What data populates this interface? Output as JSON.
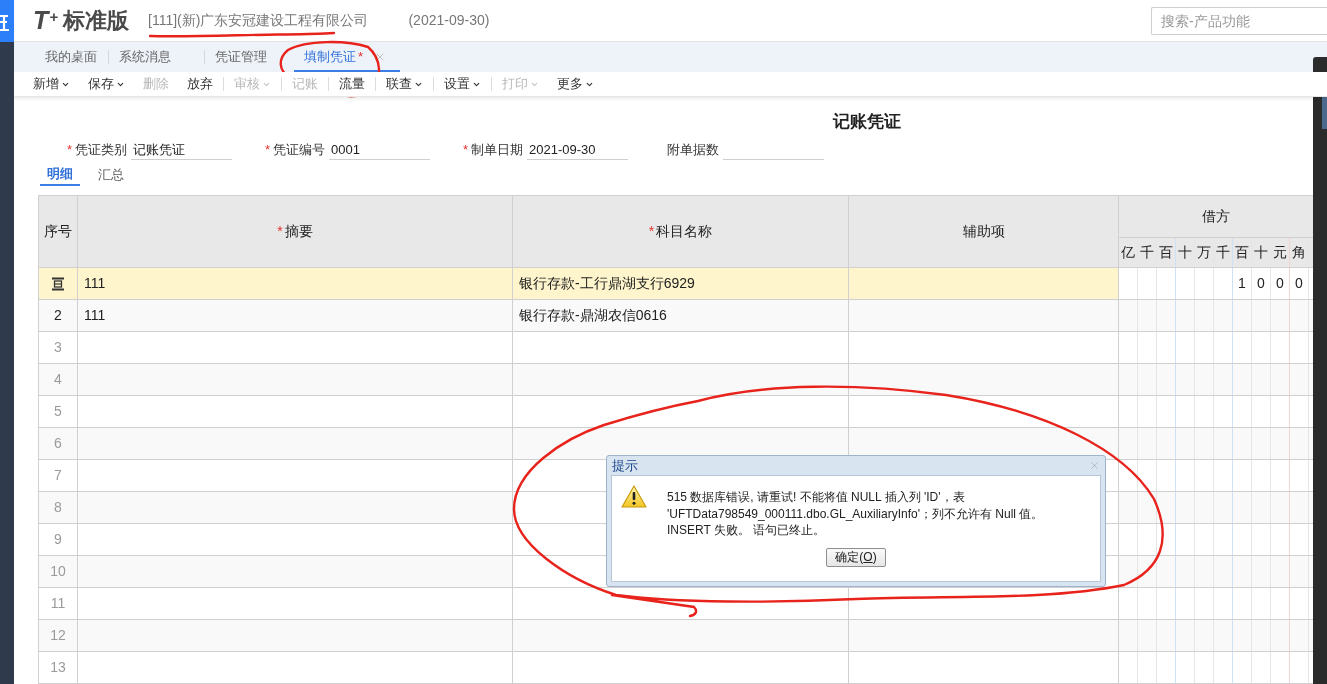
{
  "app": {
    "logo_mark": "T$^{+}$",
    "edition": "标准版",
    "company": "[111](新)广东安冠建设工程有限公司",
    "date": "(2021-09-30)"
  },
  "search": {
    "placeholder": "搜索-产品功能"
  },
  "tabs": [
    {
      "label": "我的桌面",
      "selected": false
    },
    {
      "label": "系统消息",
      "selected": false
    },
    {
      "label": "凭证管理",
      "selected": false
    },
    {
      "label": "填制凭证",
      "modified_mark": "*",
      "selected": true,
      "closable": true
    }
  ],
  "toolbar": [
    {
      "label": "新增",
      "menu": true,
      "disabled": false,
      "separator_after": false
    },
    {
      "label": "保存",
      "menu": true,
      "disabled": false,
      "separator_after": false
    },
    {
      "label": "删除",
      "menu": false,
      "disabled": true,
      "separator_after": false
    },
    {
      "label": "放弃",
      "menu": false,
      "disabled": false,
      "separator_after": true
    },
    {
      "label": "审核",
      "menu": true,
      "disabled": true,
      "separator_after": true
    },
    {
      "label": "记账",
      "menu": false,
      "disabled": true,
      "separator_after": true
    },
    {
      "label": "流量",
      "menu": false,
      "disabled": false,
      "separator_after": true
    },
    {
      "label": "联查",
      "menu": true,
      "disabled": false,
      "separator_after": true
    },
    {
      "label": "设置",
      "menu": true,
      "disabled": false,
      "separator_after": true
    },
    {
      "label": "打印",
      "menu": true,
      "disabled": true,
      "separator_after": false
    },
    {
      "label": "更多",
      "menu": true,
      "disabled": false,
      "separator_after": false
    }
  ],
  "voucher": {
    "title": "记账凭证",
    "fields": [
      {
        "required_mark": "*",
        "label": "凭证类别",
        "value": "记账凭证"
      },
      {
        "required_mark": "*",
        "label": "凭证编号",
        "value": "0001"
      },
      {
        "required_mark": "*",
        "label": "制单日期",
        "value": "2021-09-30"
      },
      {
        "label": "附单据数"
      }
    ],
    "view_tabs": [
      {
        "label": "明细",
        "selected": true
      },
      {
        "label": "汇总",
        "selected": false
      }
    ]
  },
  "table": {
    "columns": [
      {
        "label": "序号"
      },
      {
        "label": "摘要",
        "required_mark": "*"
      },
      {
        "label": "科目名称",
        "required_mark": "*"
      },
      {
        "label": "辅助项"
      }
    ],
    "debit": {
      "label": "借方",
      "digits": [
        "亿",
        "千",
        "百",
        "十",
        "万",
        "千",
        "百",
        "十",
        "元",
        "角"
      ]
    },
    "rows": [
      {
        "selected": true,
        "summary": "111",
        "account": "银行存款-工行鼎湖支行6929",
        "debit_digits": [
          "1",
          "0",
          "0",
          "0"
        ]
      },
      {
        "selected": false,
        "seq": "2",
        "summary": "111",
        "account": "银行存款-鼎湖农信0616"
      },
      {
        "selected": false,
        "seq": "3"
      },
      {
        "selected": false,
        "seq": "4"
      },
      {
        "selected": false,
        "seq": "5"
      },
      {
        "selected": false,
        "seq": "6"
      },
      {
        "selected": false,
        "seq": "7"
      },
      {
        "selected": false,
        "seq": "8"
      },
      {
        "selected": false,
        "seq": "9"
      },
      {
        "selected": false,
        "seq": "10"
      },
      {
        "selected": false,
        "seq": "11"
      },
      {
        "selected": false,
        "seq": "12"
      },
      {
        "selected": false,
        "seq": "13"
      }
    ]
  },
  "dialog": {
    "title": "提示",
    "message_lines": [
      "515 数据库错误, 请重试! 不能将值 NULL 插入列 'ID'，表",
      "'UFTData798549_000111.dbo.GL_AuxiliaryInfo'；列不允许有 Null 值。",
      "INSERT 失败。 语句已终止。"
    ],
    "button": {
      "label": "确定(",
      "mnemonic": "O",
      "label_end": ")"
    }
  }
}
